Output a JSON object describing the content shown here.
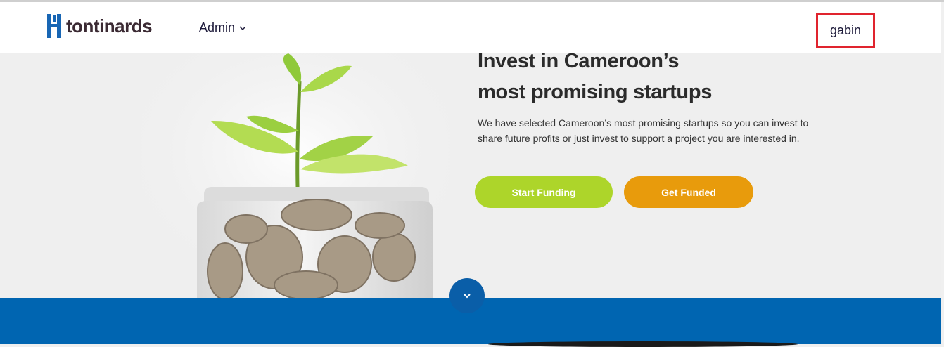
{
  "header": {
    "logo_text": "tontinards",
    "nav_admin_label": "Admin",
    "user_name": "gabin"
  },
  "hero": {
    "headline_line1": "Invest in Cameroon’s",
    "headline_line2": "most promising startups",
    "description": "We have selected Cameroon’s most promising startups so you can invest to share future profits or just invest to support a project you are interested in.",
    "start_funding_label": "Start Funding",
    "get_funded_label": "Get Funded"
  },
  "colors": {
    "brand_blue": "#0065b1",
    "start_button": "#add52a",
    "get_funded_button": "#e89b0c",
    "highlight_box": "#e0242e"
  },
  "icons": {
    "logo": "logo-mark-icon",
    "nav_dropdown": "chevron-down-icon",
    "scroll_down": "chevron-down-circle-icon"
  }
}
